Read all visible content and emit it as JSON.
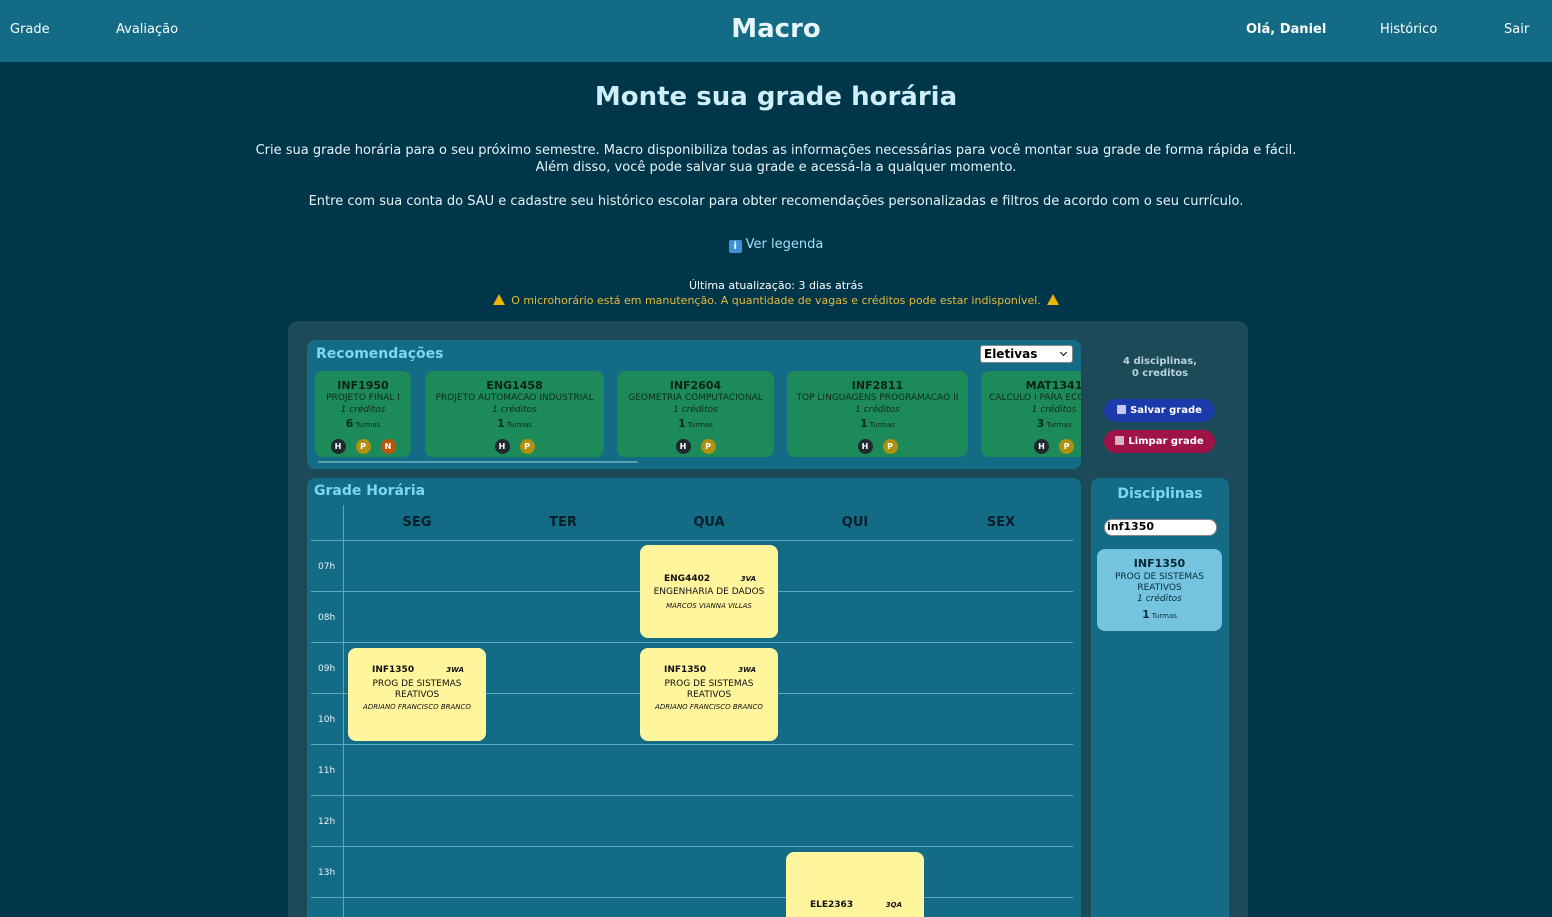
{
  "nav": {
    "grade": "Grade",
    "avaliacao": "Avaliação",
    "brand": "Macro",
    "hello": "Olá, Daniel",
    "historico": "Histórico",
    "sair": "Sair"
  },
  "hero": {
    "title": "Monte sua grade horária",
    "line1": "Crie sua grade horária para o seu próximo semestre. Macro disponibiliza todas as informações necessárias para você montar sua grade de forma rápida e fácil.",
    "line2": "Além disso, você pode salvar sua grade e acessá-la a qualquer momento.",
    "line3": "Entre com sua conta do SAU e cadastre seu histórico escolar para obter recomendações personalizadas e filtros de acordo com o seu currículo.",
    "legend_link": "Ver legenda",
    "legend_icon": "info-icon",
    "updated": "Última atualização: 3 dias atrás",
    "warning": "O microhorário está em manutenção. A quantidade de vagas e créditos pode estar indisponível.",
    "warning_color": "#e7b93a"
  },
  "recommendations": {
    "title": "Recomendações",
    "filter_selected": "Eletivas",
    "turmas_label": "Turmas",
    "cards": [
      {
        "code": "INF1950",
        "name": "PROJETO FINAL I",
        "credits": "1 créditos",
        "turmas": "6",
        "badges": [
          "H",
          "P",
          "N"
        ]
      },
      {
        "code": "ENG1458",
        "name": "PROJETO AUTOMACAO INDUSTRIAL",
        "credits": "1 créditos",
        "turmas": "1",
        "badges": [
          "H",
          "P"
        ]
      },
      {
        "code": "INF2604",
        "name": "GEOMETRIA COMPUTACIONAL",
        "credits": "1 créditos",
        "turmas": "1",
        "badges": [
          "H",
          "P"
        ]
      },
      {
        "code": "INF2811",
        "name": "TOP LINGUAGENS PROGRAMACAO II",
        "credits": "1 créditos",
        "turmas": "1",
        "badges": [
          "H",
          "P"
        ]
      },
      {
        "code": "MAT1341",
        "name": "CALCULO I PARA ECO",
        "credits": "1 créditos",
        "turmas": "3",
        "badges": [
          "H",
          "P"
        ]
      }
    ]
  },
  "summary": {
    "disciplinas": "4 disciplinas,",
    "creditos": "0 creditos",
    "save_label": "Salvar grade",
    "clear_label": "Limpar grade",
    "save_color": "#1c3aa9",
    "clear_color": "#a01347"
  },
  "grade": {
    "title": "Grade Horária",
    "days": [
      "SEG",
      "TER",
      "QUA",
      "QUI",
      "SEX"
    ],
    "hours": [
      "07h",
      "08h",
      "09h",
      "10h",
      "11h",
      "12h",
      "13h"
    ],
    "events": [
      {
        "code": "ENG4402",
        "turma": "3VA",
        "name": "ENGENHARIA DE DADOS",
        "prof": "MARCOS VIANNA VILLAS"
      },
      {
        "code": "INF1350",
        "turma": "3WA",
        "name": "PROG DE SISTEMAS REATIVOS",
        "prof": "ADRIANO FRANCISCO BRANCO"
      },
      {
        "code": "INF1350",
        "turma": "3WA",
        "name": "PROG DE SISTEMAS REATIVOS",
        "prof": "ADRIANO FRANCISCO BRANCO"
      },
      {
        "code": "ELE2363",
        "turma": "3QA",
        "name": "",
        "prof": ""
      }
    ]
  },
  "disciplinas": {
    "title": "Disciplinas",
    "search_value": "inf1350",
    "turmas_label": "Turmas",
    "card": {
      "code": "INF1350",
      "name": "PROG DE SISTEMAS REATIVOS",
      "credits": "1 créditos",
      "turmas": "1"
    }
  }
}
